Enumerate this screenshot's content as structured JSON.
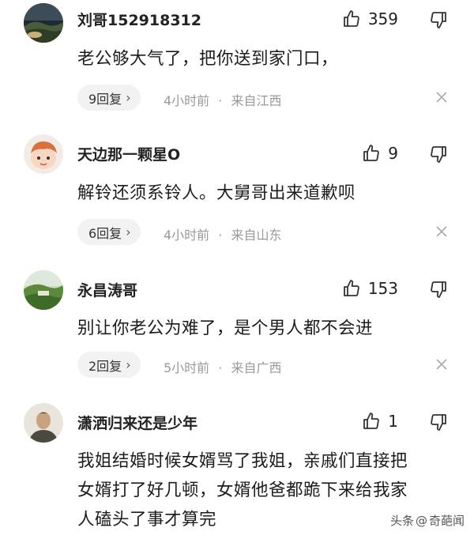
{
  "comments": [
    {
      "username": "刘哥152918312",
      "likes": "359",
      "text": "老公够大气了，把你送到家门口，",
      "replies": "9回复",
      "time": "4小时前",
      "dot": "·",
      "location": "来自江西",
      "avatar_icon": "landscape-avatar"
    },
    {
      "username": "天边那一颗星O",
      "likes": "9",
      "text": "解铃还须系铃人。大舅哥出来道歉呗",
      "replies": "6回复",
      "time": "4小时前",
      "dot": "·",
      "location": "来自山东",
      "avatar_icon": "cartoon-avatar"
    },
    {
      "username": "永昌涛哥",
      "likes": "153",
      "text": "别让你老公为难了，是个男人都不会进",
      "replies": "2回复",
      "time": "5小时前",
      "dot": "·",
      "location": "来自广西",
      "avatar_icon": "landscape-avatar"
    },
    {
      "username": "潇洒归来还是少年",
      "likes": "1",
      "text_lines": [
        "我姐结婚时候女婿骂了我姐，亲戚们直接把",
        "女婿打了好几顿，女婿他爸都跪下来给我家",
        "人磕头了事才算完"
      ],
      "avatar_icon": "portrait-avatar"
    }
  ],
  "footer": {
    "brand_left": "头条",
    "brand_at": "@",
    "brand_right": "奇葩闻"
  },
  "colors": {
    "text": "#222222",
    "meta": "#999999",
    "reply_bg": "#f2f2f2"
  },
  "chevron": "›"
}
